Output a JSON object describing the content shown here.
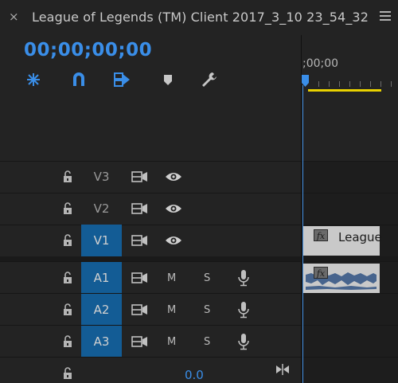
{
  "window": {
    "tab_title": "League of Legends (TM) Client 2017_3_10 23_54_32",
    "close_glyph": "×"
  },
  "timeline": {
    "timecode": "00;00;00;00",
    "ruler_time": ";00;00",
    "accent_color": "#3a8ee8",
    "work_area_color": "#e8d100",
    "tools": [
      {
        "name": "ripple-snap-icon"
      },
      {
        "name": "magnet-snap-icon"
      },
      {
        "name": "linked-selection-icon"
      },
      {
        "name": "add-marker-icon"
      },
      {
        "name": "wrench-settings-icon"
      }
    ]
  },
  "tracks": {
    "v3": {
      "label": "V3",
      "targeted": false
    },
    "v2": {
      "label": "V2",
      "targeted": false
    },
    "v1": {
      "label": "V1",
      "targeted": true
    },
    "a1": {
      "label": "A1",
      "targeted": true,
      "mute": "M",
      "solo": "S"
    },
    "a2": {
      "label": "A2",
      "targeted": true,
      "mute": "M",
      "solo": "S"
    },
    "a3": {
      "label": "A3",
      "targeted": true,
      "mute": "M",
      "solo": "S"
    }
  },
  "clips": {
    "video_title": "League",
    "fx_label": "fx"
  },
  "footer": {
    "master_volume": "0.0"
  }
}
